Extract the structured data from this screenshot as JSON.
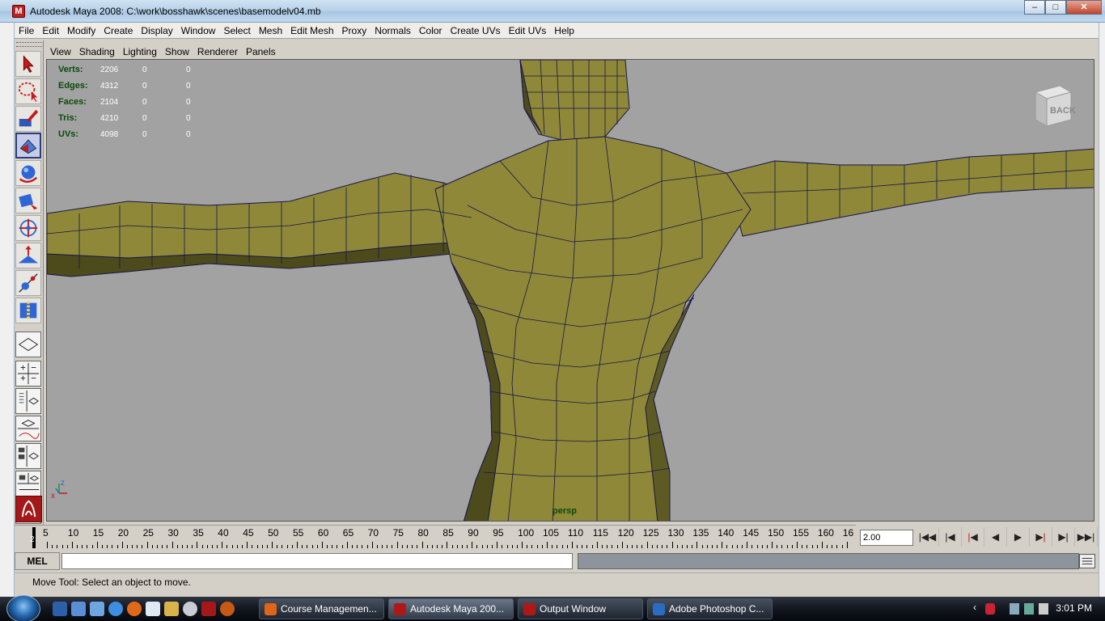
{
  "window": {
    "title": "Autodesk Maya 2008: C:\\work\\bosshawk\\scenes\\basemodelv04.mb",
    "buttons": [
      "–",
      "□",
      "✕"
    ]
  },
  "menubar": [
    "File",
    "Edit",
    "Modify",
    "Create",
    "Display",
    "Window",
    "Select",
    "Mesh",
    "Edit Mesh",
    "Proxy",
    "Normals",
    "Color",
    "Create UVs",
    "Edit UVs",
    "Help"
  ],
  "toolbox": {
    "tools": [
      "select-tool",
      "lasso-tool",
      "paint-selection-tool",
      "move-tool",
      "rotate-tool",
      "scale-tool",
      "universal-manipulator",
      "soft-modification-tool",
      "show-manipulator-tool",
      "last-used-tool"
    ],
    "active": "move-tool",
    "layouts": [
      "single-perspective-layout",
      "four-view-layout",
      "outliner-persp-layout",
      "persp-graph-layout",
      "hypershade-persp-layout",
      "persp-graph-hypershade-layout",
      "graph-editor-layout"
    ]
  },
  "panel_menu": [
    "View",
    "Shading",
    "Lighting",
    "Show",
    "Renderer",
    "Panels"
  ],
  "hud": {
    "rows": [
      {
        "label": "Verts:",
        "v1": "2206",
        "v2": "0",
        "v3": "0"
      },
      {
        "label": "Edges:",
        "v1": "4312",
        "v2": "0",
        "v3": "0"
      },
      {
        "label": "Faces:",
        "v1": "2104",
        "v2": "0",
        "v3": "0"
      },
      {
        "label": "Tris:",
        "v1": "4210",
        "v2": "0",
        "v3": "0"
      },
      {
        "label": "UVs:",
        "v1": "4098",
        "v2": "0",
        "v3": "0"
      }
    ]
  },
  "viewcube": {
    "face": "BACK"
  },
  "camera": "persp",
  "axis_labels": {
    "x": "x",
    "z": "z"
  },
  "colors": {
    "mesh_fill": "#8f8838",
    "mesh_shadow": "#4d4a1c",
    "wire": "#16164a",
    "viewport_bg": "#a2a2a2",
    "hud_text": "#0a4a0a"
  },
  "timeline": {
    "current": "2",
    "ticks": [
      "5",
      "10",
      "15",
      "20",
      "25",
      "30",
      "35",
      "40",
      "45",
      "50",
      "55",
      "60",
      "65",
      "70",
      "75",
      "80",
      "85",
      "90",
      "95",
      "100",
      "105",
      "110",
      "115",
      "120",
      "125",
      "130",
      "135",
      "140",
      "145",
      "150",
      "155",
      "160",
      "16"
    ],
    "current_time": "2.00",
    "playback_buttons": [
      "go-to-start",
      "step-back-key",
      "step-back-frame",
      "play-backwards",
      "play-forwards",
      "step-forward-frame",
      "step-forward-key",
      "go-to-end"
    ]
  },
  "command_line": {
    "label": "MEL",
    "value": ""
  },
  "help_line": "Move Tool: Select an object to move.",
  "taskbar": {
    "tasks": [
      {
        "label": "Course Managemen...",
        "icon_color": "#e0651a"
      },
      {
        "label": "Autodesk Maya 200...",
        "icon_color": "#b01818"
      },
      {
        "label": "Output Window",
        "icon_color": "#b01818"
      },
      {
        "label": "Adobe Photoshop C...",
        "icon_color": "#2b6cc0"
      }
    ],
    "active_index": 1,
    "clock": "3:01 PM"
  }
}
